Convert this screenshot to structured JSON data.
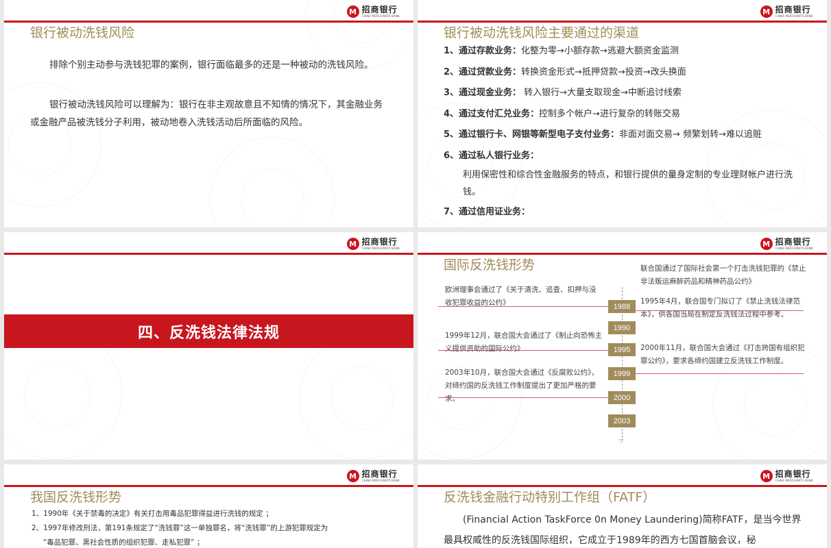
{
  "brand": {
    "logo_mark": "M",
    "logo_cn": "招商银行",
    "logo_en": "CHINA MERCHANTS BANK",
    "accent_color": "#c8161e",
    "title_color": "#a08c5b"
  },
  "slide1": {
    "title": "银行被动洗钱风险",
    "para1": "排除个别主动参与洗钱犯罪的案例，银行面临最多的还是一种被动的洗钱风险。",
    "para2": "银行被动洗钱风险可以理解为：银行在非主观故意且不知情的情况下，其金融业务或金融产品被洗钱分子利用，被动地卷入洗钱活动后所面临的风险。"
  },
  "slide2": {
    "title": "银行被动洗钱风险主要通过的渠道",
    "items": [
      {
        "head": "1、通过存款业务：",
        "body": "化整为零→小额存款→逃避大额资金监测"
      },
      {
        "head": "2、通过贷款业务：",
        "body": "转换资金形式→抵押贷款→投资→改头换面"
      },
      {
        "head": "3、通过现金业务：",
        "body": " 转入银行→大量支取现金→中断追讨线索"
      },
      {
        "head": "4、通过支付汇兑业务：",
        "body": "控制多个帐户→进行复杂的转账交易"
      },
      {
        "head": "5、通过银行卡、网银等新型电子支付业务：",
        "body": "非面对面交易→ 频繁划转→难以追赃"
      },
      {
        "head": "6、通过私人银行业务：",
        "body": ""
      }
    ],
    "sub": "利用保密性和综合性金融服务的特点，和银行提供的量身定制的专业理财帐户进行洗钱。",
    "item7": "7、通过信用证业务："
  },
  "slide3": {
    "band_title": "四、反洗钱法律法规"
  },
  "slide4": {
    "title": "国际反洗钱形势",
    "years": [
      "1988",
      "1990",
      "1995",
      "1999",
      "2000",
      "2003"
    ],
    "left_notes": [
      "欧洲理事会通过了《关于清洗、追查、扣押与没收犯罪收益的公约》",
      "1999年12月，联合国大会通过了《制止向恐怖主义提供资助的国际公约》",
      "2003年10月，联合国大会通过《反腐败公约》，对缔约国的反洗钱工作制度提出了更加严格的要求。"
    ],
    "right_notes": [
      "联合国通过了国际社会第一个打击洗钱犯罪的《禁止非法贩运麻醉药品和精神药品公约》",
      "1995年4月，联合国专门拟订了《禁止洗钱法律范本》，供各国当局在制定反洗钱法过程中参考。",
      "2000年11月，联合国大会通过《打击跨国有组织犯罪公约》，要求各缔约国建立反洗钱工作制度。"
    ]
  },
  "slide5": {
    "title": "我国反洗钱形势",
    "lines": [
      "1、1990年《关于禁毒的决定》有关打击用毒品犯罪得益进行洗钱的规定 ；",
      "2、1997年修改刑法，第191条规定了“洗钱罪”这一单独罪名，将“洗钱罪”的上游犯罪规定为",
      "     “毒品犯罪、黑社会性质的组织犯罪、走私犯罪” ；"
    ]
  },
  "slide6": {
    "title": "反洗钱金融行动特别工作组（FATF）",
    "para": "(Financial Action TaskForce 0n Money Laundering)简称FATF，是当今世界最具权威性的反洗钱国际组织，它成立于1989年的西方七国首脑会议，秘"
  }
}
